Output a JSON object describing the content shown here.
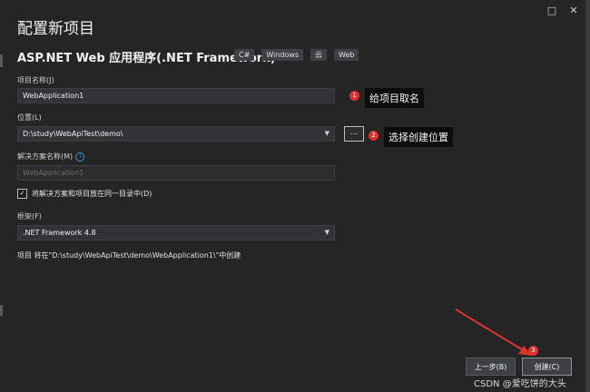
{
  "window": {
    "title": "配置新项目",
    "maximize_glyph": "□",
    "close_glyph": "✕"
  },
  "project_type": {
    "name": "ASP.NET Web 应用程序(.NET Framework)",
    "tags": [
      "C#",
      "Windows",
      "云",
      "Web"
    ]
  },
  "fields": {
    "project_name": {
      "label": "项目名称(J)",
      "value": "WebApplication1"
    },
    "location": {
      "label": "位置(L)",
      "value": "D:\\study\\WebApiTest\\demo\\",
      "browse_label": "..."
    },
    "solution_name": {
      "label": "解决方案名称(M)",
      "value": "WebApplication1"
    },
    "same_directory": {
      "label": "将解决方案和项目放在同一目录中(D)",
      "checked": true
    },
    "framework": {
      "label": "框架(F)",
      "value": ".NET Framework 4.8"
    }
  },
  "create_path_note": "项目 将在\"D:\\study\\WebApiTest\\demo\\WebApplication1\\\"中创建",
  "annotations": [
    {
      "number": "1",
      "text": "给项目取名"
    },
    {
      "number": "2",
      "text": "选择创建位置"
    },
    {
      "number": "3",
      "text": ""
    }
  ],
  "buttons": {
    "back": "上一步(B)",
    "create": "创建(C)"
  },
  "watermark": "CSDN @爱吃饼的大头",
  "colors": {
    "background": "#252526",
    "annotation_badge": "#e03131",
    "annotation_arrow": "#e03131",
    "info_icon": "#3a96dd"
  },
  "icons": {
    "info": "info-icon",
    "check": "check-icon",
    "dropdown": "chevron-down-icon"
  }
}
